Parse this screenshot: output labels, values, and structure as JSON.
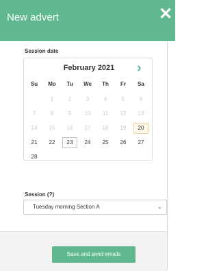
{
  "header": {
    "title": "New advert",
    "close_icon": "close-icon"
  },
  "session_date": {
    "label": "Session date",
    "calendar": {
      "month_label": "February 2021",
      "next_icon": "chevron-right-icon",
      "weekdays": [
        "Su",
        "Mo",
        "Tu",
        "We",
        "Th",
        "Fr",
        "Sa"
      ],
      "weeks": [
        [
          "",
          "1",
          "2",
          "3",
          "4",
          "5",
          "6"
        ],
        [
          "7",
          "8",
          "9",
          "10",
          "11",
          "12",
          "13"
        ],
        [
          "14",
          "15",
          "16",
          "17",
          "18",
          "19",
          "20"
        ],
        [
          "21",
          "22",
          "23",
          "24",
          "25",
          "26",
          "27"
        ],
        [
          "28",
          "",
          "",
          "",
          "",
          "",
          ""
        ]
      ],
      "today": "20",
      "selected": "23"
    }
  },
  "session": {
    "label": "Session (?)",
    "selected_value": "Tuesday morning Section A",
    "chevron_icon": "chevron-down-icon"
  },
  "footer": {
    "save_label": "Save and send emails"
  },
  "colors": {
    "accent": "#5fb88f"
  }
}
